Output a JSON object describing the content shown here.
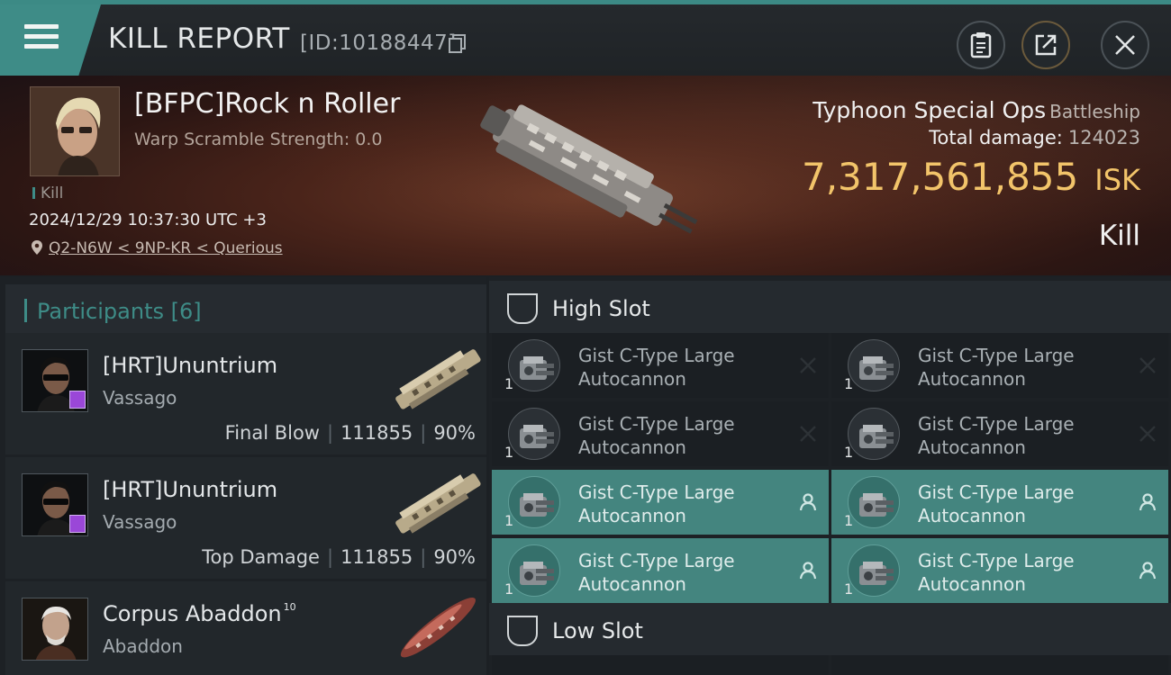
{
  "header": {
    "title": "KILL REPORT",
    "report_id": "[ID:10188447]"
  },
  "victim": {
    "name": "[BFPC]Rock n Roller",
    "scramble": "Warp Scramble Strength: 0.0",
    "tag": "Kill",
    "timestamp": "2024/12/29 10:37:30 UTC +3",
    "location": "Q2-N6W < 9NP-KR < Querious",
    "ship": "Typhoon Special Ops",
    "ship_class": "Battleship",
    "total_damage_label": "Total damage:",
    "total_damage": "124023",
    "isk_value": "7,317,561,855",
    "isk_unit": "ISK",
    "result": "Kill"
  },
  "participants": {
    "label": "Participants",
    "count": "[6]",
    "rows": [
      {
        "name": "[HRT]Ununtrium",
        "ship": "Vassago",
        "role": "Final Blow",
        "damage": "111855",
        "percent": "90%"
      },
      {
        "name": "[HRT]Ununtrium",
        "ship": "Vassago",
        "role": "Top Damage",
        "damage": "111855",
        "percent": "90%"
      },
      {
        "name": "Corpus Abaddon",
        "level": "10",
        "ship": "Abaddon"
      }
    ]
  },
  "slots": {
    "high_label": "High Slot",
    "low_label": "Low Slot",
    "high_modules": [
      {
        "line1": "Gist C-Type Large",
        "line2": "Autocannon",
        "qty": "1",
        "status": "destroyed"
      },
      {
        "line1": "Gist C-Type Large",
        "line2": "Autocannon",
        "qty": "1",
        "status": "destroyed"
      },
      {
        "line1": "Gist C-Type Large",
        "line2": "Autocannon",
        "qty": "1",
        "status": "destroyed"
      },
      {
        "line1": "Gist C-Type Large",
        "line2": "Autocannon",
        "qty": "1",
        "status": "destroyed"
      },
      {
        "line1": "Gist C-Type Large",
        "line2": "Autocannon",
        "qty": "1",
        "status": "dropped"
      },
      {
        "line1": "Gist C-Type Large",
        "line2": "Autocannon",
        "qty": "1",
        "status": "dropped"
      },
      {
        "line1": "Gist C-Type Large",
        "line2": "Autocannon",
        "qty": "1",
        "status": "dropped"
      },
      {
        "line1": "Gist C-Type Large",
        "line2": "Autocannon",
        "qty": "1",
        "status": "dropped"
      }
    ]
  },
  "colors": {
    "accent": "#3e8c87",
    "isk": "#f2c46a",
    "fitted_module": "#44857f",
    "badge": "#9a47d8"
  },
  "icons": {
    "menu": "hamburger-icon",
    "copy": "copy-icon",
    "clipboard": "clipboard-icon",
    "share": "share-icon",
    "close": "close-icon",
    "location": "location-pin-icon",
    "destroyed": "x-icon",
    "dropped": "person-icon",
    "slot": "slot-shield-icon"
  }
}
